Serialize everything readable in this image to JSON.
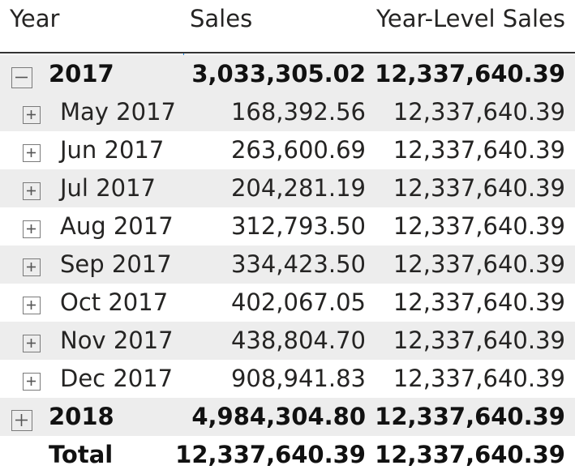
{
  "headers": {
    "year": "Year",
    "sales": "Sales",
    "year_level_sales": "Year-Level Sales"
  },
  "rows": [
    {
      "type": "year",
      "label": "2017",
      "sales": "3,033,305.02",
      "year_level_sales": "12,337,640.39",
      "expanded": true,
      "toggle_icon": "collapse-icon"
    },
    {
      "type": "month",
      "label": "May 2017",
      "sales": "168,392.56",
      "year_level_sales": "12,337,640.39",
      "toggle_icon": "expand-icon"
    },
    {
      "type": "month",
      "label": "Jun 2017",
      "sales": "263,600.69",
      "year_level_sales": "12,337,640.39",
      "toggle_icon": "expand-icon"
    },
    {
      "type": "month",
      "label": "Jul 2017",
      "sales": "204,281.19",
      "year_level_sales": "12,337,640.39",
      "toggle_icon": "expand-icon"
    },
    {
      "type": "month",
      "label": "Aug 2017",
      "sales": "312,793.50",
      "year_level_sales": "12,337,640.39",
      "toggle_icon": "expand-icon"
    },
    {
      "type": "month",
      "label": "Sep 2017",
      "sales": "334,423.50",
      "year_level_sales": "12,337,640.39",
      "toggle_icon": "expand-icon"
    },
    {
      "type": "month",
      "label": "Oct 2017",
      "sales": "402,067.05",
      "year_level_sales": "12,337,640.39",
      "toggle_icon": "expand-icon"
    },
    {
      "type": "month",
      "label": "Nov 2017",
      "sales": "438,804.70",
      "year_level_sales": "12,337,640.39",
      "toggle_icon": "expand-icon"
    },
    {
      "type": "month",
      "label": "Dec 2017",
      "sales": "908,941.83",
      "year_level_sales": "12,337,640.39",
      "toggle_icon": "expand-icon"
    },
    {
      "type": "year",
      "label": "2018",
      "sales": "4,984,304.80",
      "year_level_sales": "12,337,640.39",
      "expanded": false,
      "toggle_icon": "expand-icon"
    }
  ],
  "total": {
    "label": "Total",
    "sales": "12,337,640.39",
    "year_level_sales": "12,337,640.39"
  },
  "colors": {
    "row_band": "#ededed",
    "column_divider": "#1e88e5",
    "header_rule": "#333333",
    "toggle_border": "#7a7a7a"
  }
}
